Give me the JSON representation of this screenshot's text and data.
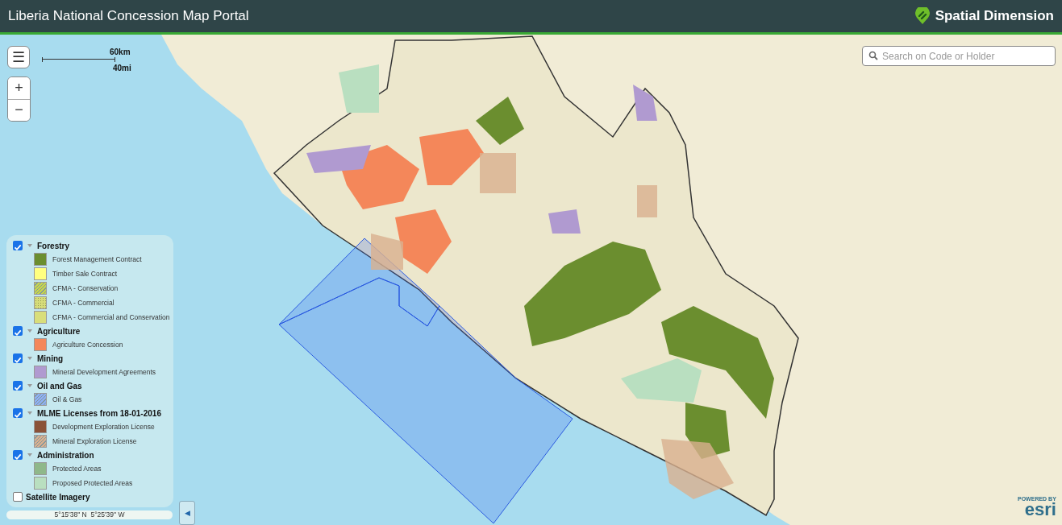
{
  "header": {
    "title": "Liberia National Concession Map Portal",
    "brand": "Spatial Dimension"
  },
  "map_controls": {
    "menu_button": "☰",
    "zoom_in": "+",
    "zoom_out": "−",
    "scale": [
      "60km",
      "40mi"
    ]
  },
  "search": {
    "placeholder": "Search on Code or Holder"
  },
  "legend": {
    "groups": [
      {
        "label": "Forestry",
        "checked": true,
        "expanded": true,
        "items": [
          {
            "label": "Forest Management Contract",
            "color": "#6b8e2f",
            "kind": "solid"
          },
          {
            "label": "Timber Sale Contract",
            "color": "#ffff80",
            "kind": "solid"
          },
          {
            "label": "CFMA - Conservation",
            "color": "#c8d64a",
            "kind": "hatch"
          },
          {
            "label": "CFMA - Commercial",
            "color": "#d6dc7a",
            "kind": "dots"
          },
          {
            "label": "CFMA - Commercial and Conservation",
            "color": "#d9de7a",
            "kind": "solid"
          }
        ]
      },
      {
        "label": "Agriculture",
        "checked": true,
        "expanded": true,
        "items": [
          {
            "label": "Agriculture Concession",
            "color": "#f4875a",
            "kind": "solid"
          }
        ]
      },
      {
        "label": "Mining",
        "checked": true,
        "expanded": true,
        "items": [
          {
            "label": "Mineral Development Agreements",
            "color": "#b09ad0",
            "kind": "solid"
          }
        ]
      },
      {
        "label": "Oil and Gas",
        "checked": true,
        "expanded": true,
        "items": [
          {
            "label": "Oil & Gas",
            "color": "#8fb0f5",
            "kind": "hatch"
          }
        ]
      },
      {
        "label": "MLME Licenses from 18-01-2016",
        "checked": true,
        "expanded": true,
        "items": [
          {
            "label": "Development Exploration License",
            "color": "#8a5238",
            "kind": "solid"
          },
          {
            "label": "Mineral Exploration License",
            "color": "#d9b08f",
            "kind": "hatch"
          }
        ]
      },
      {
        "label": "Administration",
        "checked": true,
        "expanded": true,
        "items": [
          {
            "label": "Protected Areas",
            "color": "#8fb88a",
            "kind": "solid"
          },
          {
            "label": "Proposed Protected Areas",
            "color": "#b9dfc0",
            "kind": "solid"
          }
        ]
      },
      {
        "label": "Satellite Imagery",
        "checked": false
      }
    ]
  },
  "coordinates": "5°15'38\" N  5°25'39\" W",
  "collapse_button": "◀",
  "attribution": {
    "line_1": "POWERED BY",
    "line_2": "esri"
  }
}
